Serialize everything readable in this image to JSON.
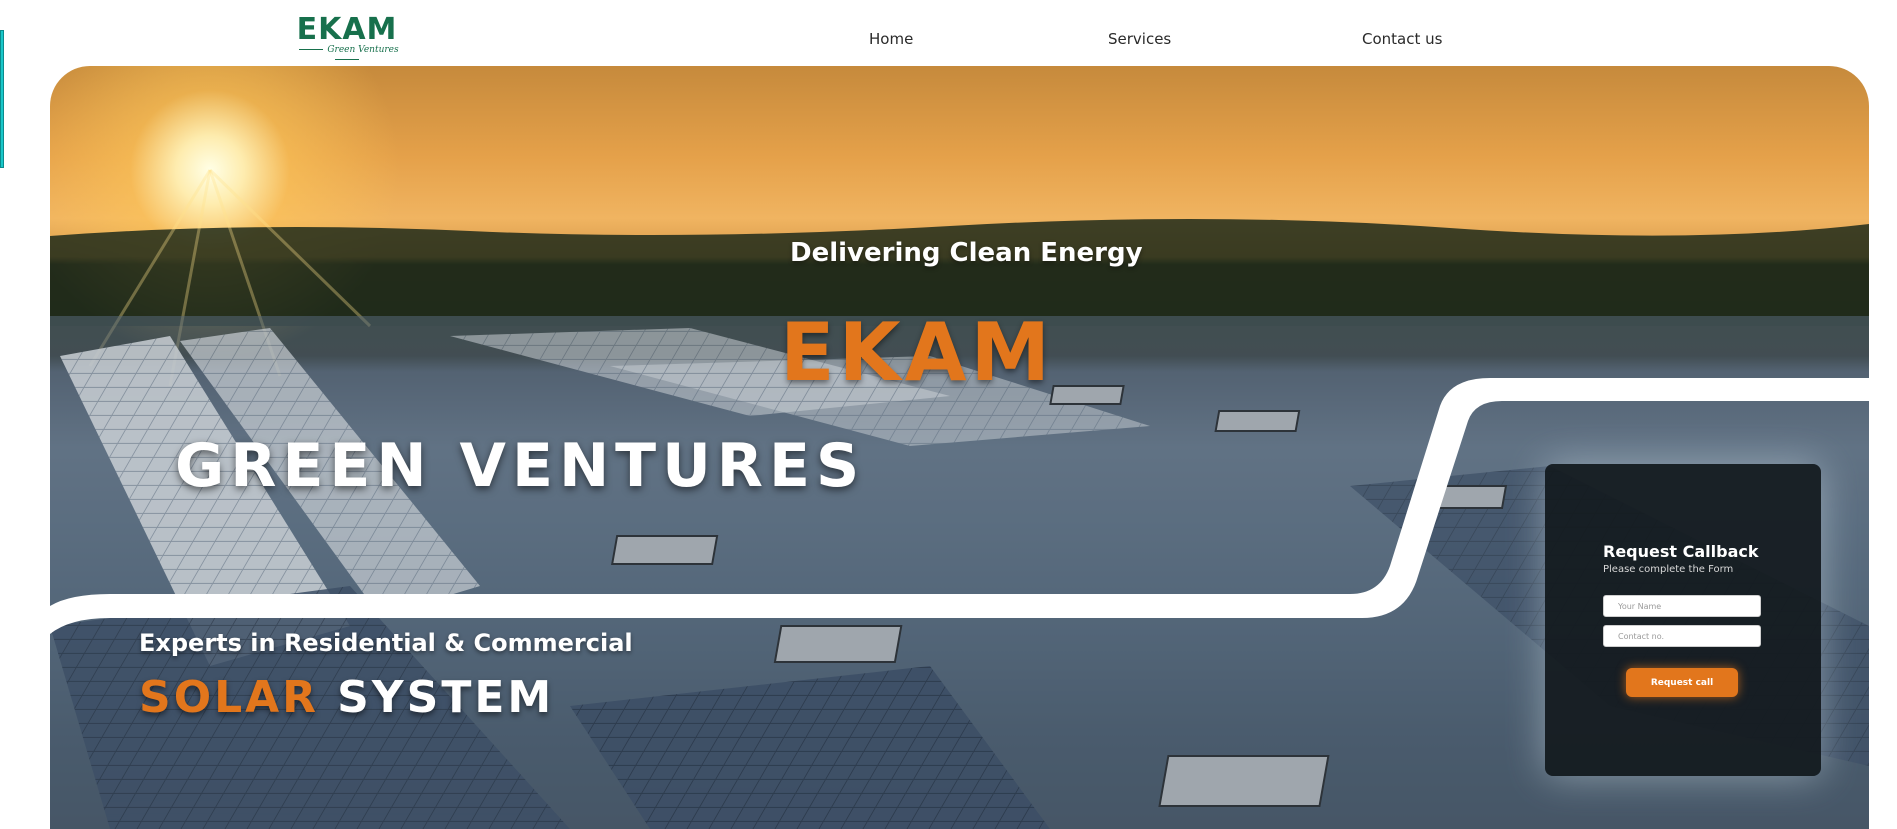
{
  "brand": {
    "logo_main": "EKAM",
    "logo_sub": "Green Ventures"
  },
  "nav": {
    "items": [
      "Home",
      "Services",
      "Contact us"
    ]
  },
  "hero": {
    "tagline": "Delivering Clean Energy",
    "brand_big": "EKAM",
    "brand_sub": "Green Ventures",
    "experts_line": "Experts in Residential & Commercial",
    "solar_word": "SOLAR",
    "system_word": "SYSTEM"
  },
  "callback": {
    "title": "Request Callback",
    "subtitle": "Please complete the Form",
    "name_placeholder": "Your Name",
    "contact_placeholder": "Contact no.",
    "button_label": "Request call"
  },
  "colors": {
    "accent": "#e2761c",
    "brand_green": "#17704c",
    "side_tab": "#19c7c9"
  }
}
